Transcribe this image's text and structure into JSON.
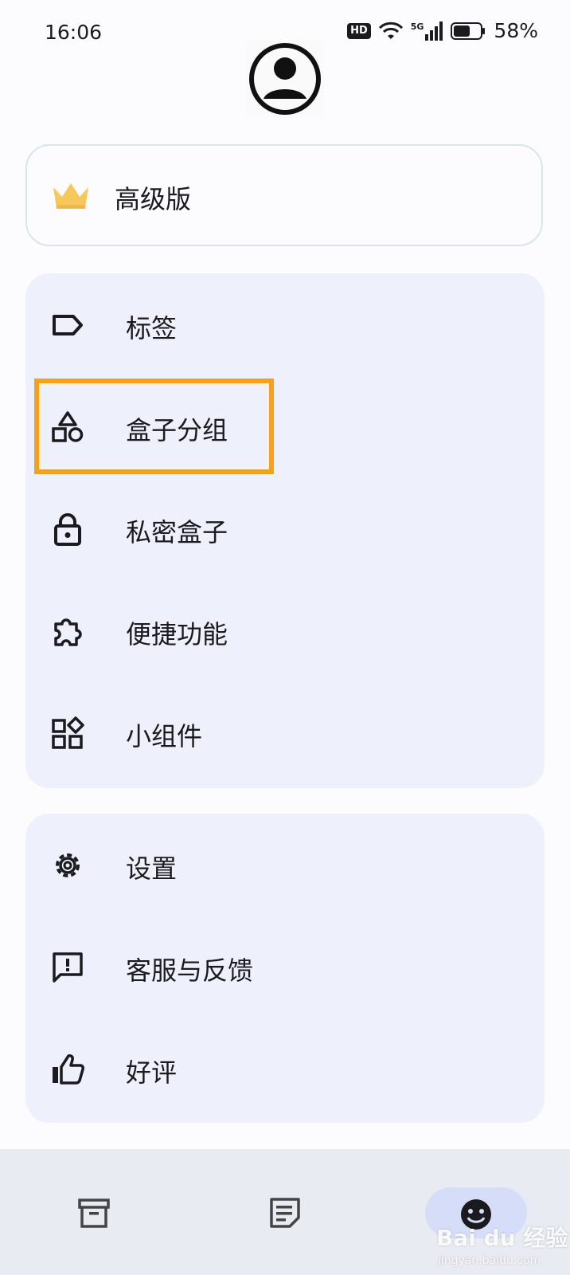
{
  "status": {
    "time": "16:06",
    "hd": "HD",
    "network": "5G",
    "battery": "58%"
  },
  "premium": {
    "label": "高级版",
    "icon": "crown-icon",
    "icon_color": "#f6c75a"
  },
  "menu_primary": [
    {
      "label": "标签",
      "icon": "tag-icon"
    },
    {
      "label": "盒子分组",
      "icon": "shapes-icon"
    },
    {
      "label": "私密盒子",
      "icon": "lock-icon"
    },
    {
      "label": "便捷功能",
      "icon": "puzzle-icon"
    },
    {
      "label": "小组件",
      "icon": "widgets-icon"
    }
  ],
  "menu_secondary": [
    {
      "label": "设置",
      "icon": "gear-icon"
    },
    {
      "label": "客服与反馈",
      "icon": "feedback-icon"
    },
    {
      "label": "好评",
      "icon": "thumbs-up-icon"
    }
  ],
  "bottom_nav": [
    {
      "icon": "archive-icon",
      "active": false
    },
    {
      "icon": "note-icon",
      "active": false
    },
    {
      "icon": "smiley-icon",
      "active": true
    }
  ],
  "highlight_color": "#f5a11f",
  "watermark": {
    "brand": "Bai du 经验",
    "url": "jingyan.baidu.com"
  }
}
